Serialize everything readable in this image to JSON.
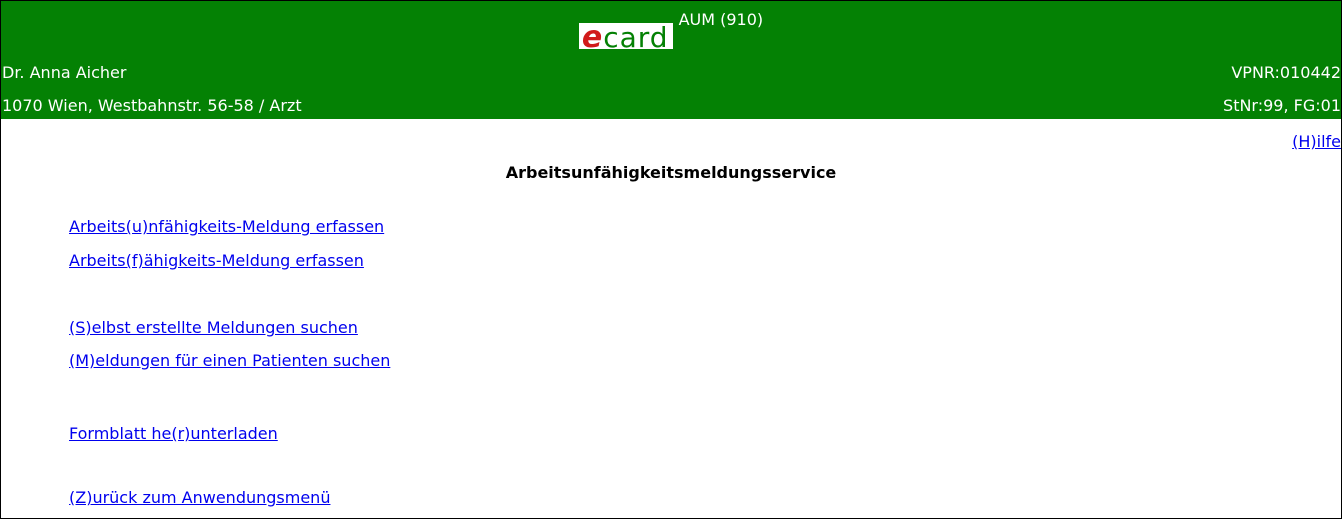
{
  "header": {
    "logo": {
      "e": "e",
      "card": "card"
    },
    "app_code": "AUM (910)",
    "doctor_name": "Dr. Anna Aicher",
    "vpnr": "VPNR:010442",
    "address": "1070 Wien, Westbahnstr. 56-58 / Arzt",
    "station": "StNr:99, FG:01",
    "colors": {
      "header_bg": "#048104",
      "logo_e": "#d11a1a",
      "link": "#0000ee"
    }
  },
  "help_link": "(H)ilfe",
  "page_title": "Arbeitsunfähigkeitsmeldungsservice",
  "menu": {
    "au_erfassen": "Arbeits(u)nfähigkeits-Meldung erfassen",
    "af_erfassen": "Arbeits(f)ähigkeits-Meldung erfassen",
    "selbst_suchen": "(S)elbst erstellte Meldungen suchen",
    "patient_suchen": "(M)eldungen für einen Patienten suchen",
    "formblatt": "Formblatt he(r)unterladen",
    "zurueck": "(Z)urück zum Anwendungsmenü"
  }
}
